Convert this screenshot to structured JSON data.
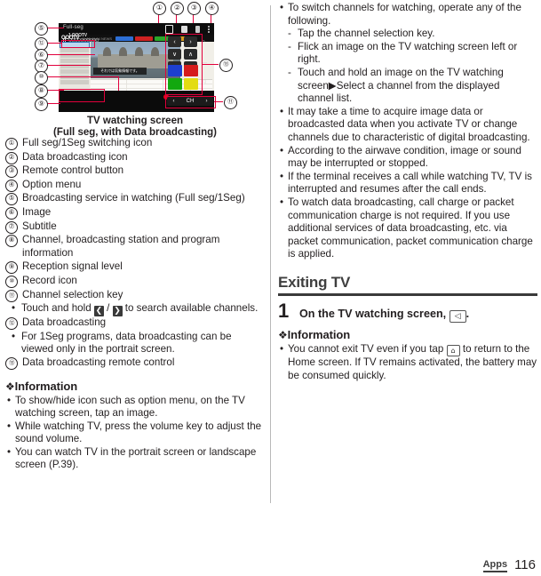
{
  "figure": {
    "caption_line1": "TV watching screen",
    "caption_line2": "(Full seg, with Data broadcasting)",
    "screenshot": {
      "app_title": "Full-seg",
      "channel_logo": "ОООTV",
      "channel_text": "11:00-11:54  NEWS",
      "subtitle_text": "それでは気象情報です。",
      "station_line1": "1 ОООTV",
      "station_line2": "ОООООООООО",
      "ch_label": "CH",
      "remote_keys": [
        "‹",
        "›",
        "∨",
        "∧",
        "↩",
        "▪"
      ],
      "color_keys": [
        "#1d3fcf",
        "#d51b1b",
        "#12a80f",
        "#e3dc12"
      ],
      "chip_colors": [
        "#2d6fd6",
        "#cf2222",
        "#2aa82a",
        "#d79a1f"
      ],
      "callout_numbers": [
        "①",
        "②",
        "③",
        "④",
        "⑤",
        "⑥",
        "⑦",
        "⑧",
        "⑨",
        "⑩",
        "⑪",
        "⑫",
        "⑬"
      ]
    }
  },
  "left_column": {
    "items": [
      {
        "num": "①",
        "text": "Full seg/1Seg switching icon"
      },
      {
        "num": "②",
        "text": "Data broadcasting icon"
      },
      {
        "num": "③",
        "text": "Remote control button"
      },
      {
        "num": "④",
        "text": "Option menu"
      },
      {
        "num": "⑤",
        "text": "Broadcasting service in watching (Full seg/1Seg)"
      },
      {
        "num": "⑥",
        "text": "Image"
      },
      {
        "num": "⑦",
        "text": "Subtitle"
      },
      {
        "num": "⑧",
        "text": "Channel, broadcasting station and program information"
      },
      {
        "num": "⑨",
        "text": "Reception signal level"
      },
      {
        "num": "⑩",
        "text": "Record icon"
      },
      {
        "num": "⑪",
        "text": "Channel selection key"
      },
      {
        "num": "⑫",
        "text": "Data broadcasting"
      },
      {
        "num": "⑬",
        "text": "Data broadcasting remote control"
      }
    ],
    "sub_ch_key_pre": "Touch and hold ",
    "sub_ch_key_left": "❮",
    "sub_ch_key_mid": " / ",
    "sub_ch_key_right": "❯",
    "sub_ch_key_post": " to search available channels.",
    "sub_data_bc": "For 1Seg programs, data broadcasting can be viewed only in the portrait screen.",
    "information_title": "Information",
    "information_bullets": [
      "To show/hide icon such as option menu, on the TV watching screen, tap an image.",
      "While watching TV, press the volume key to adjust the sound volume.",
      "You can watch TV in the portrait screen or landscape screen (P.39)."
    ]
  },
  "right_column": {
    "bullets_top": [
      "To switch channels for watching, operate any of the following."
    ],
    "dashes": [
      "Tap the channel selection key.",
      "Flick an image on the TV watching screen left or right.",
      "Touch and hold an image on the TV watching screen▶Select a channel from the displayed channel list."
    ],
    "bullets_rest": [
      "It may take a time to acquire image data or broadcasted data when you activate TV or change channels due to characteristic of digital broadcasting.",
      "According to the airwave condition, image or sound may be interrupted or stopped.",
      "If the terminal receives a call while watching TV, TV is interrupted and resumes after the call ends.",
      "To watch data broadcasting, call charge or packet communication charge is not required. If you use additional services of data broadcasting, etc. via packet communication, packet communication charge is applied."
    ],
    "heading": "Exiting TV",
    "step_number": "1",
    "step_text_pre": "On the TV watching screen, ",
    "step_key": "◁",
    "step_text_post": ".",
    "information_title": "Information",
    "info_pre": "You cannot exit TV even if you tap ",
    "info_key": "⌂",
    "info_post": " to return to the Home screen. If TV remains activated, the battery may be consumed quickly."
  },
  "footer": {
    "section": "Apps",
    "page": "116"
  }
}
